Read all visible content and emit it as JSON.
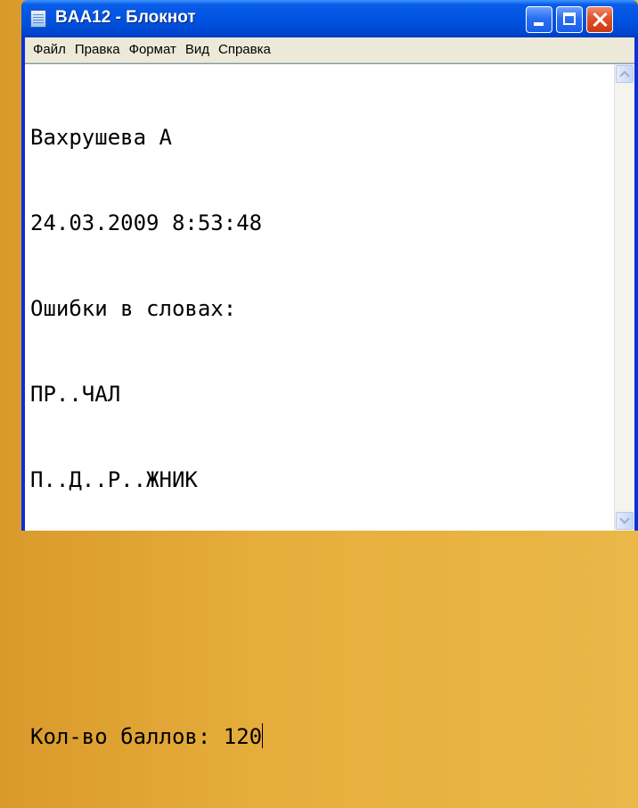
{
  "window": {
    "title": "BAA12 - Блокнот"
  },
  "menu": {
    "items": [
      "Файл",
      "Правка",
      "Формат",
      "Вид",
      "Справка"
    ]
  },
  "document": {
    "lines": [
      "Вахрушева А",
      "24.03.2009 8:53:48",
      "Ошибки в словах:",
      "ПР..ЧАЛ",
      "П..Д..Р..ЖНИК",
      "",
      "",
      "Кол-во баллов: 120"
    ]
  },
  "colors": {
    "titlebar": "#0054e3",
    "menubar": "#ece9d8",
    "close_button": "#e0512b",
    "desktop": "#e6ad3c"
  },
  "icons": {
    "app": "notepad-icon",
    "minimize": "minimize-icon",
    "maximize": "maximize-icon",
    "close": "close-icon",
    "scroll_up": "scroll-up-arrow-icon",
    "scroll_down": "scroll-down-arrow-icon"
  }
}
